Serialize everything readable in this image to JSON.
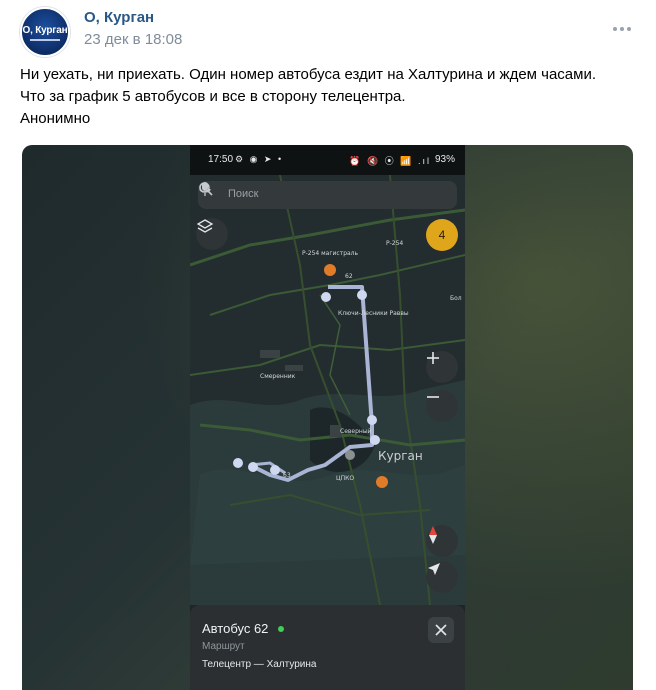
{
  "post": {
    "group_name": "О, Курган",
    "avatar_text": "О, Курган",
    "date": "23 дек в 18:08",
    "more_icon": "more-dots-icon",
    "text_lines": [
      "Ни уехать, ни приехать. Один номер автобуса ездит на Халтурина и ждем часами.",
      "Что за график 5 автобусов и все в сторону телецентра.",
      "Анонимно"
    ]
  },
  "screenshot": {
    "status_bar": {
      "time": "17:50",
      "left_icons": "⚙ ◉ ➤ •",
      "right_icons": "⏰ 🔇 ⦿ 📶 .ıl",
      "battery": "93%"
    },
    "search": {
      "placeholder": "Поиск"
    },
    "badge_count": "4",
    "map_labels": {
      "road_p254": "Р-254 магистраль",
      "p254_sign": "Р-254",
      "klyuchi": "Ключи-Лесники Раввы",
      "vremennik": "Смеренник",
      "severny": "Северный",
      "kurgan": "Курган",
      "tsipko": "ЦПКО",
      "bol": "Бол",
      "route_62": "62",
      "route_63": "63"
    },
    "sheet": {
      "title": "Автобус 62",
      "subtitle": "Маршрут",
      "route": "Телецентр — Халтурина"
    }
  },
  "colors": {
    "link": "#2a5885",
    "meta": "#818c99",
    "route_line": "#aab5d6",
    "badge": "#e0a61b",
    "live": "#3fcf55"
  }
}
